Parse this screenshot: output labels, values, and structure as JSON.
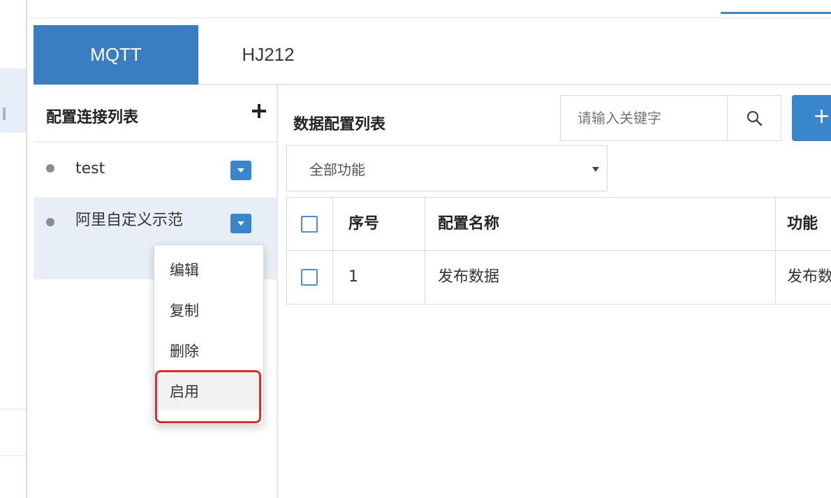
{
  "tabs": [
    {
      "label": "MQTT"
    },
    {
      "label": "HJ212"
    }
  ],
  "connections": {
    "title": "配置连接列表",
    "add_icon": "plus-icon",
    "items": [
      {
        "name": "test"
      },
      {
        "name": "阿里自定义示范"
      }
    ]
  },
  "context_menu": {
    "items": [
      {
        "label": "编辑"
      },
      {
        "label": "复制"
      },
      {
        "label": "删除"
      },
      {
        "label": "启用"
      }
    ],
    "highlight_color": "#e02a2a"
  },
  "data_config": {
    "title": "数据配置列表",
    "search": {
      "placeholder": "请输入关键字",
      "icon": "search-icon"
    },
    "add_label": "+",
    "filter": {
      "selected": "全部功能"
    },
    "table": {
      "headers": [
        "序号",
        "配置名称",
        "功能"
      ],
      "rows": [
        [
          "1",
          "发布数据",
          "发布数据"
        ]
      ]
    }
  },
  "colors": {
    "accent": "#3a7dc0",
    "button": "#3a86cc"
  }
}
